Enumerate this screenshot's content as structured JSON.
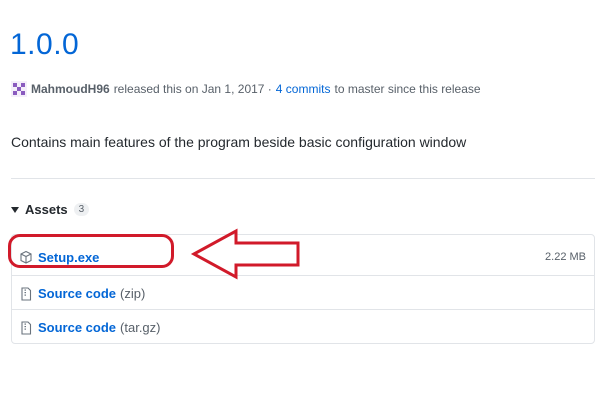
{
  "release": {
    "title": "1.0.0",
    "author": "MahmoudH96",
    "released_text": "released this on Jan 1, 2017 ·",
    "commits_link": "4 commits",
    "commits_suffix": "to master since this release",
    "description": "Contains main features of the program beside basic configuration window"
  },
  "assets": {
    "label": "Assets",
    "count": "3",
    "items": [
      {
        "name": "Setup.exe",
        "ext": "",
        "size": "2.22 MB",
        "icon": "package-icon"
      },
      {
        "name": "Source code",
        "ext": "(zip)",
        "size": "",
        "icon": "file-zip-icon"
      },
      {
        "name": "Source code",
        "ext": "(tar.gz)",
        "size": "",
        "icon": "file-zip-icon"
      }
    ]
  },
  "colors": {
    "link": "#0366d6",
    "annotation": "#d11a2a",
    "muted": "#586069"
  }
}
